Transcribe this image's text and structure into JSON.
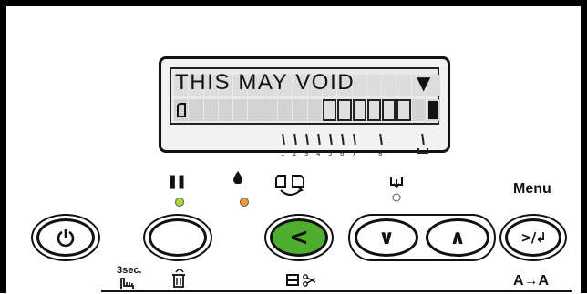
{
  "display": {
    "line1": "THIS MAY VOID",
    "line1_right_glyph": "▼",
    "paper_glyph": "🗋",
    "indicator_glyph": "■",
    "ticks": [
      "1",
      "2",
      "3",
      "4",
      "5",
      "6",
      "7",
      "8"
    ],
    "last_tick_icon": "ink-tray-icon"
  },
  "labels": {
    "menu": "Menu",
    "three_sec": "3sec.",
    "a_to_a": "A→A"
  },
  "buttons": {
    "power": "⏻",
    "pause": "",
    "back": "<",
    "down": "∨",
    "up": "∧",
    "menu_enter": "≫/↵"
  },
  "icons": {
    "pause": "❚❚",
    "ink": "●",
    "paper_source": "⎘",
    "hand": "☛",
    "trash": "🗑",
    "paper_cut": "✂",
    "align": "⇩"
  },
  "colors": {
    "green_button": "#4fae2f",
    "led_green": "#a8d83a",
    "led_orange": "#f39a3a"
  }
}
